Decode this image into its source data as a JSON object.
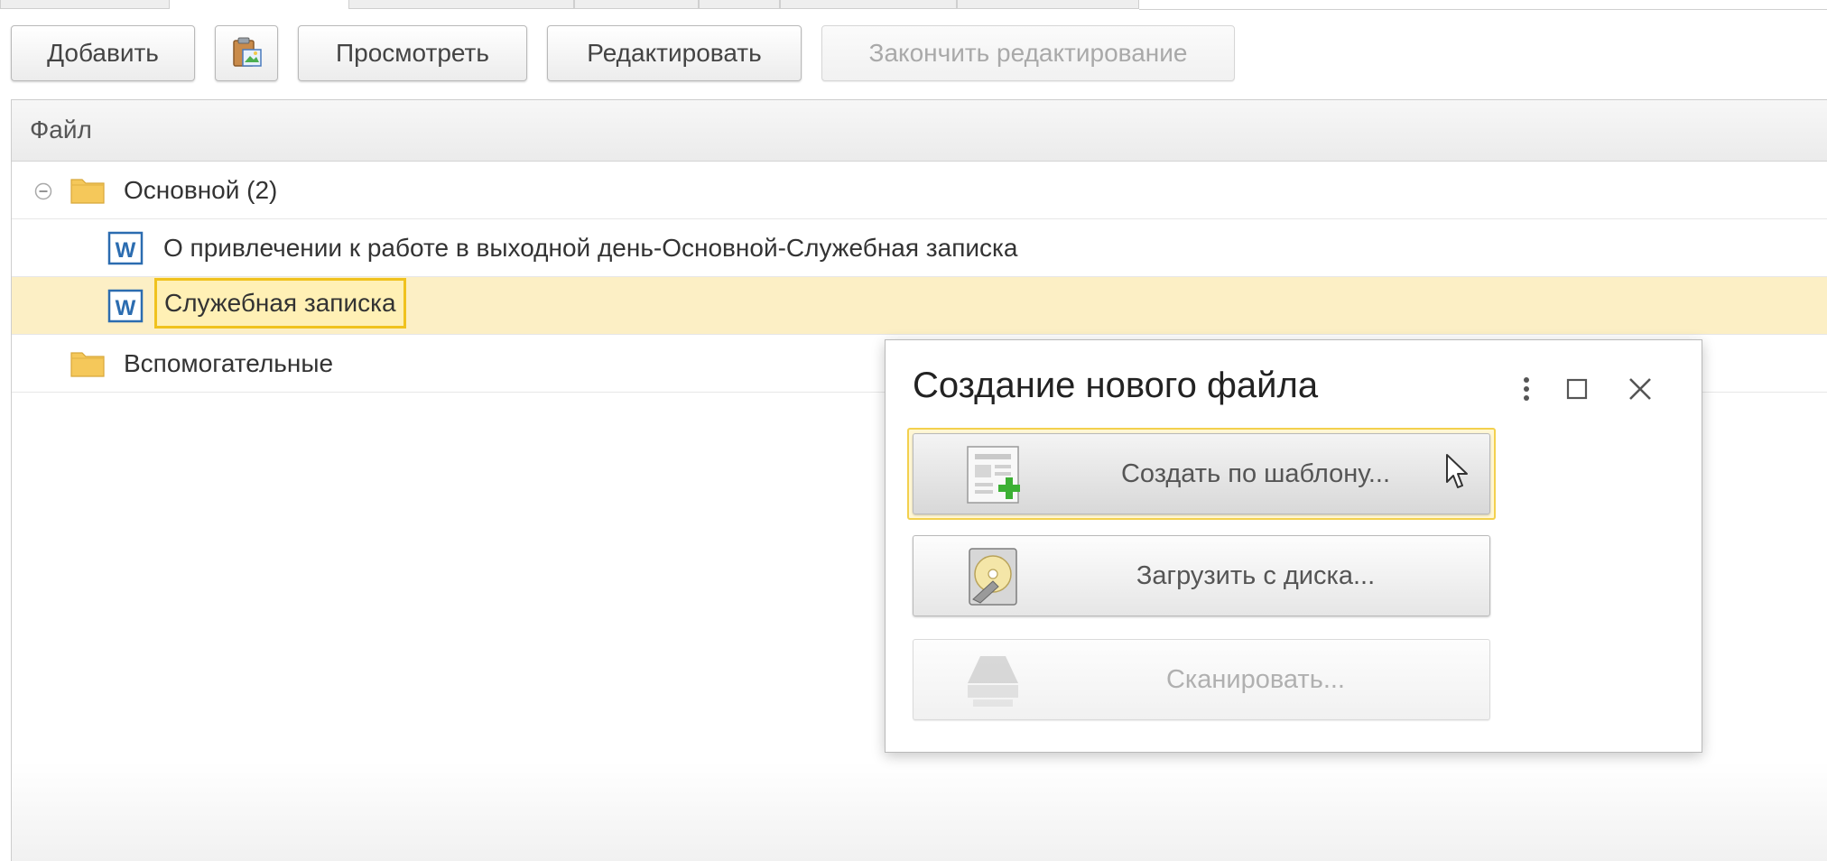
{
  "toolbar": {
    "add_label": "Добавить",
    "view_label": "Просмотреть",
    "edit_label": "Редактировать",
    "finish_edit_label": "Закончить редактирование"
  },
  "list": {
    "column_header": "Файл",
    "groups": [
      {
        "label": "Основной (2)",
        "expanded": true
      },
      {
        "label": "Вспомогательные",
        "expanded": false
      }
    ],
    "files": [
      {
        "label": "О привлечении к работе в выходной день-Основной-Служебная записка"
      },
      {
        "label": "Служебная записка",
        "selected": true
      }
    ]
  },
  "dialog": {
    "title": "Создание нового файла",
    "buttons": {
      "template_label": "Создать по шаблону...",
      "disk_label": "Загрузить с диска...",
      "scan_label": "Сканировать..."
    }
  },
  "colors": {
    "selection_fill": "#fcefc5",
    "selection_border": "#f0c21e",
    "folder": "#f5c85a",
    "word_icon": "#2b6cb0",
    "plus_green": "#3cb034"
  }
}
